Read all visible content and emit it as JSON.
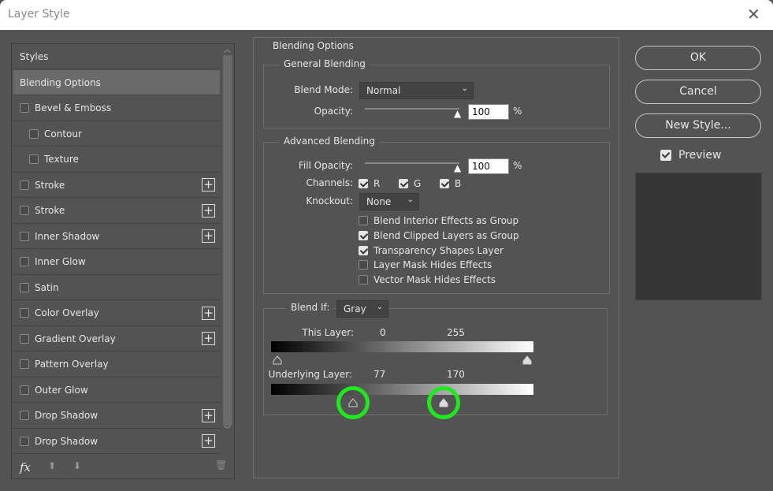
{
  "window": {
    "title": "Layer Style",
    "close": "✕"
  },
  "styles_list": {
    "header": "Styles",
    "items": [
      {
        "label": "Blending Options",
        "selected": true
      },
      {
        "label": "Bevel & Emboss",
        "checked": false
      },
      {
        "label": "Contour",
        "checked": false,
        "indent": true
      },
      {
        "label": "Texture",
        "checked": false,
        "indent": true
      },
      {
        "label": "Stroke",
        "checked": false,
        "plus": true
      },
      {
        "label": "Stroke",
        "checked": false,
        "plus": true
      },
      {
        "label": "Inner Shadow",
        "checked": false,
        "plus": true
      },
      {
        "label": "Inner Glow",
        "checked": false
      },
      {
        "label": "Satin",
        "checked": false
      },
      {
        "label": "Color Overlay",
        "checked": false,
        "plus": true
      },
      {
        "label": "Gradient Overlay",
        "checked": false,
        "plus": true
      },
      {
        "label": "Pattern Overlay",
        "checked": false
      },
      {
        "label": "Outer Glow",
        "checked": false
      },
      {
        "label": "Drop Shadow",
        "checked": false,
        "plus": true
      },
      {
        "label": "Drop Shadow",
        "checked": false,
        "plus": true
      }
    ],
    "fx": "fx"
  },
  "blending": {
    "title": "Blending Options",
    "general": {
      "title": "General Blending",
      "blend_mode_label": "Blend Mode:",
      "blend_mode": "Normal",
      "opacity_label": "Opacity:",
      "opacity": "100",
      "pct": "%"
    },
    "advanced": {
      "title": "Advanced Blending",
      "fill_label": "Fill Opacity:",
      "fill": "100",
      "pct": "%",
      "channels_label": "Channels:",
      "r": "R",
      "g": "G",
      "b": "B",
      "knockout_label": "Knockout:",
      "knockout": "None",
      "options": [
        {
          "label": "Blend Interior Effects as Group",
          "checked": false
        },
        {
          "label": "Blend Clipped Layers as Group",
          "checked": true
        },
        {
          "label": "Transparency Shapes Layer",
          "checked": true
        },
        {
          "label": "Layer Mask Hides Effects",
          "checked": false
        },
        {
          "label": "Vector Mask Hides Effects",
          "checked": false
        }
      ]
    },
    "blend_if": {
      "label": "Blend If:",
      "channel": "Gray",
      "this_layer_label": "This Layer:",
      "this_low": "0",
      "this_high": "255",
      "under_label": "Underlying Layer:",
      "under_low": "77",
      "under_high": "170"
    }
  },
  "buttons": {
    "ok": "OK",
    "cancel": "Cancel",
    "new_style": "New Style...",
    "preview": "Preview"
  },
  "colors": {
    "highlight": "#1fe81f",
    "panel": "#535353"
  }
}
